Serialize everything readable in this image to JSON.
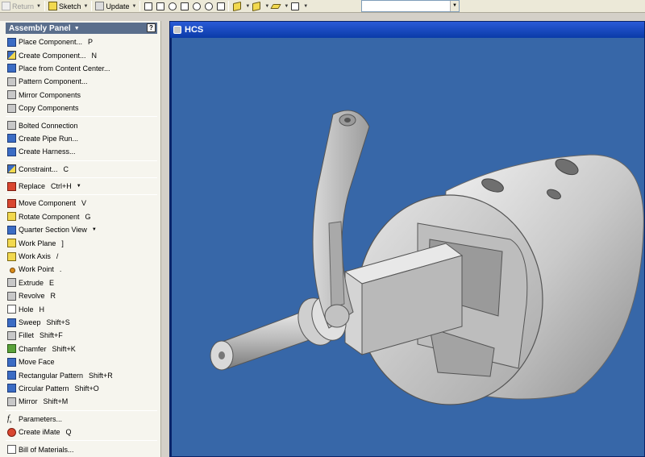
{
  "toolbar": {
    "return_label": "Return",
    "sketch_label": "Sketch",
    "update_label": "Update",
    "combo_value": ""
  },
  "panel": {
    "title": "Assembly Panel",
    "help_glyph": "?",
    "groups": [
      [
        {
          "label": "Place Component...",
          "shortcut": "P"
        },
        {
          "label": "Create Component...",
          "shortcut": "N"
        },
        {
          "label": "Place from Content Center...",
          "shortcut": ""
        },
        {
          "label": "Pattern Component...",
          "shortcut": ""
        },
        {
          "label": "Mirror Components",
          "shortcut": ""
        },
        {
          "label": "Copy Components",
          "shortcut": ""
        }
      ],
      [
        {
          "label": "Bolted Connection",
          "shortcut": ""
        },
        {
          "label": "Create Pipe Run...",
          "shortcut": ""
        },
        {
          "label": "Create Harness...",
          "shortcut": ""
        }
      ],
      [
        {
          "label": "Constraint...",
          "shortcut": "C"
        }
      ],
      [
        {
          "label": "Replace",
          "shortcut": "Ctrl+H"
        }
      ],
      [
        {
          "label": "Move Component",
          "shortcut": "V"
        },
        {
          "label": "Rotate Component",
          "shortcut": "G"
        },
        {
          "label": "Quarter Section View",
          "shortcut": ""
        },
        {
          "label": "Work Plane",
          "shortcut": "]"
        },
        {
          "label": "Work Axis",
          "shortcut": "/"
        },
        {
          "label": "Work Point",
          "shortcut": "."
        },
        {
          "label": "Extrude",
          "shortcut": "E"
        },
        {
          "label": "Revolve",
          "shortcut": "R"
        },
        {
          "label": "Hole",
          "shortcut": "H"
        },
        {
          "label": "Sweep",
          "shortcut": "Shift+S"
        },
        {
          "label": "Fillet",
          "shortcut": "Shift+F"
        },
        {
          "label": "Chamfer",
          "shortcut": "Shift+K"
        },
        {
          "label": "Move Face",
          "shortcut": ""
        },
        {
          "label": "Rectangular Pattern",
          "shortcut": "Shift+R"
        },
        {
          "label": "Circular Pattern",
          "shortcut": "Shift+O"
        },
        {
          "label": "Mirror",
          "shortcut": "Shift+M"
        }
      ],
      [
        {
          "label": "Parameters...",
          "shortcut": ""
        },
        {
          "label": "Create iMate",
          "shortcut": "Q"
        }
      ],
      [
        {
          "label": "Bill of Materials...",
          "shortcut": ""
        }
      ]
    ]
  },
  "window": {
    "title": "HCS"
  },
  "colors": {
    "viewport_bg": "#3767a8",
    "titlebar": "#0a3ba8",
    "panel_header": "#5a6e8c"
  }
}
